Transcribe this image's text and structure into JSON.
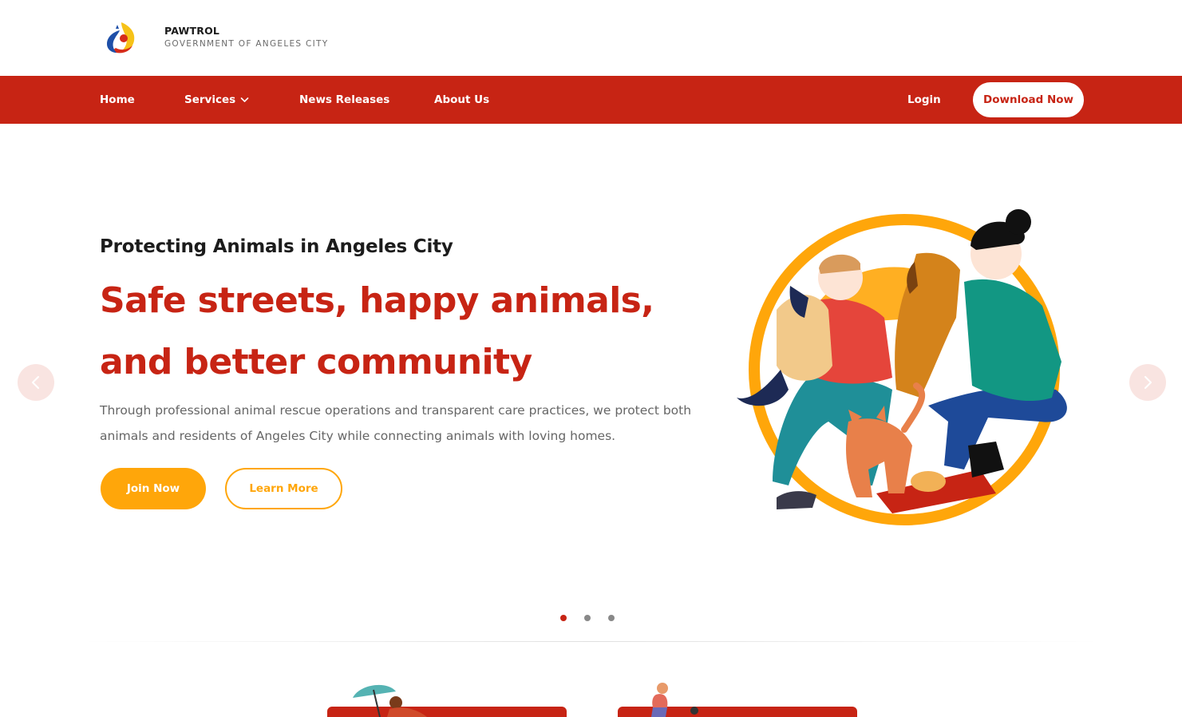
{
  "brand": {
    "name": "PAWTROL",
    "subtitle": "GOVERNMENT OF ANGELES CITY",
    "logo_icon": "pawtrol-logo-icon",
    "colors": {
      "red": "#c72414",
      "yellow": "#ffa60a",
      "blue": "#1e5fb3"
    }
  },
  "nav": {
    "home": "Home",
    "services": "Services",
    "news": "News Releases",
    "about": "About Us",
    "login": "Login",
    "download": "Download Now"
  },
  "hero": {
    "kicker": "Protecting Animals in Angeles City",
    "title": "Safe streets, happy animals, and better community",
    "description": "Through professional animal rescue operations and transparent care practices, we protect both animals and residents of Angeles City while connecting animals with loving homes.",
    "join_label": "Join Now",
    "learn_label": "Learn More",
    "illustration_icon": "people-with-pets-illustration"
  },
  "carousel": {
    "prev_icon": "chevron-left-icon",
    "next_icon": "chevron-right-icon",
    "slide_count": 3,
    "active_slide": 1
  },
  "colors": {
    "accent_red": "#c72414",
    "accent_yellow": "#ffa60a",
    "text_gray": "#666666"
  }
}
